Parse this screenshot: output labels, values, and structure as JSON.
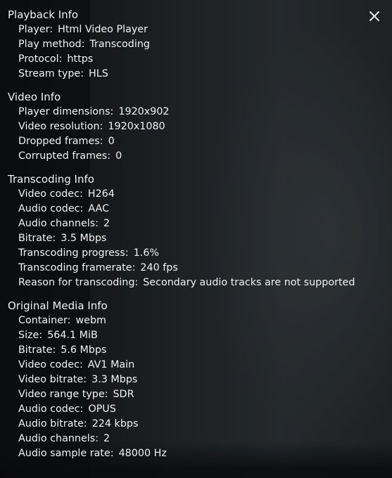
{
  "close_icon": "close-icon",
  "sections": {
    "playback": {
      "title": "Playback Info",
      "rows": [
        {
          "label": "Player",
          "value": "Html Video Player"
        },
        {
          "label": "Play method",
          "value": "Transcoding"
        },
        {
          "label": "Protocol",
          "value": "https"
        },
        {
          "label": "Stream type",
          "value": "HLS"
        }
      ]
    },
    "video": {
      "title": "Video Info",
      "rows": [
        {
          "label": "Player dimensions",
          "value": "1920x902"
        },
        {
          "label": "Video resolution",
          "value": "1920x1080"
        },
        {
          "label": "Dropped frames",
          "value": "0"
        },
        {
          "label": "Corrupted frames",
          "value": "0"
        }
      ]
    },
    "transcoding": {
      "title": "Transcoding Info",
      "rows": [
        {
          "label": "Video codec",
          "value": "H264"
        },
        {
          "label": "Audio codec",
          "value": "AAC"
        },
        {
          "label": "Audio channels",
          "value": "2"
        },
        {
          "label": "Bitrate",
          "value": "3.5 Mbps"
        },
        {
          "label": "Transcoding progress",
          "value": "1.6%"
        },
        {
          "label": "Transcoding framerate",
          "value": "240 fps"
        },
        {
          "label": "Reason for transcoding",
          "value": "Secondary audio tracks are not supported"
        }
      ]
    },
    "original": {
      "title": "Original Media Info",
      "rows": [
        {
          "label": "Container",
          "value": "webm"
        },
        {
          "label": "Size",
          "value": "564.1 MiB"
        },
        {
          "label": "Bitrate",
          "value": "5.6 Mbps"
        },
        {
          "label": "Video codec",
          "value": "AV1 Main"
        },
        {
          "label": "Video bitrate",
          "value": "3.3 Mbps"
        },
        {
          "label": "Video range type",
          "value": "SDR"
        },
        {
          "label": "Audio codec",
          "value": "OPUS"
        },
        {
          "label": "Audio bitrate",
          "value": "224 kbps"
        },
        {
          "label": "Audio channels",
          "value": "2"
        },
        {
          "label": "Audio sample rate",
          "value": "48000 Hz"
        }
      ]
    }
  }
}
